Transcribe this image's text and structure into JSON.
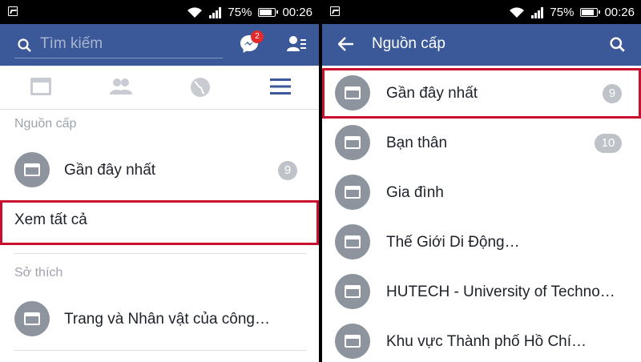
{
  "status": {
    "battery": "75%",
    "time": "00:26",
    "battery_level": 0.75
  },
  "left": {
    "search_placeholder": "Tìm kiếm",
    "messenger_badge": "2",
    "section_feeds": "Nguồn cấp",
    "feed_item": {
      "label": "Gần đây nhất",
      "count": "9"
    },
    "see_all": "Xem tất cả",
    "section_interests": "Sở thích",
    "interest_item": {
      "label": "Trang và Nhân vật của công…"
    }
  },
  "right": {
    "title": "Nguồn cấp",
    "items": [
      {
        "label": "Gần đây nhất",
        "count": "9"
      },
      {
        "label": "Bạn thân",
        "count": "10"
      },
      {
        "label": "Gia đình"
      },
      {
        "label": "Thế Giới Di Động…"
      },
      {
        "label": "HUTECH - University of Techno…"
      },
      {
        "label": "Khu vực Thành phố Hồ Chí…"
      }
    ]
  },
  "colors": {
    "brand": "#3b5998",
    "highlight": "#c8102e",
    "badge": "#e32b2b"
  },
  "icons": [
    "image-icon",
    "wifi-icon",
    "signal-icon",
    "battery-icon",
    "search-icon",
    "messenger-icon",
    "friend-requests-icon",
    "news-feed-icon",
    "friends-icon",
    "globe-icon",
    "menu-icon",
    "back-arrow-icon",
    "feed-icon"
  ]
}
